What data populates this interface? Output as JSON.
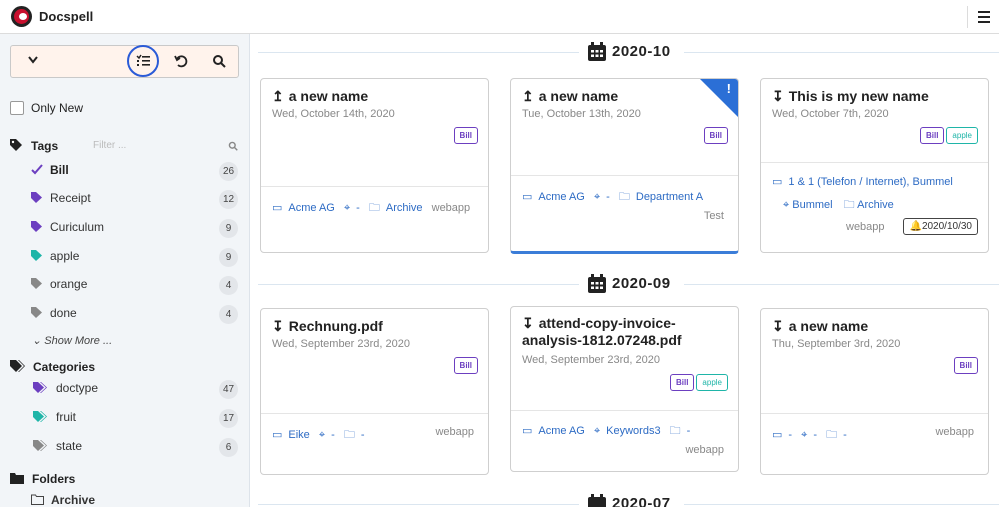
{
  "app": {
    "title": "Docspell"
  },
  "sidebar": {
    "only_new_label": "Only New",
    "tags_title": "Tags",
    "filter_placeholder": "Filter ...",
    "tags": [
      {
        "name": "Bill",
        "count": "26",
        "color": "#6c3fc0",
        "active": true
      },
      {
        "name": "Receipt",
        "count": "12",
        "color": "#6c3fc0"
      },
      {
        "name": "Curiculum",
        "count": "9",
        "color": "#6c3fc0"
      },
      {
        "name": "apple",
        "count": "9",
        "color": "#1fb5a8"
      },
      {
        "name": "orange",
        "count": "4",
        "color": "#888888"
      },
      {
        "name": "done",
        "count": "4",
        "color": "#888888"
      }
    ],
    "show_more": "Show More ...",
    "categories_title": "Categories",
    "categories": [
      {
        "name": "doctype",
        "count": "47",
        "color": "#6c3fc0"
      },
      {
        "name": "fruit",
        "count": "17",
        "color": "#1fb5a8"
      },
      {
        "name": "state",
        "count": "6",
        "color": "#888888"
      }
    ],
    "folders_title": "Folders",
    "folders": [
      {
        "name": "Archive"
      }
    ]
  },
  "groups": [
    {
      "month": "2020-10"
    },
    {
      "month": "2020-09"
    },
    {
      "month": "2020-07"
    }
  ],
  "cards": [
    {
      "title": "a new name",
      "direction": "↥",
      "date": "Wed, October 14th, 2020",
      "tags": [
        "Bill"
      ],
      "correspondent": "Acme AG",
      "concerning": "-",
      "folder": "Archive",
      "source": "webapp"
    },
    {
      "title": "a new name",
      "direction": "↥",
      "date": "Tue, October 13th, 2020",
      "tags": [
        "Bill"
      ],
      "correspondent": "Acme AG",
      "concerning": "-",
      "folder": "Department A",
      "source": "Test",
      "new_mark": "!"
    },
    {
      "title": "This is my new name",
      "direction": "↧",
      "date": "Wed, October 7th, 2020",
      "tags": [
        "Bill",
        "apple"
      ],
      "correspondent": "1 & 1 (Telefon / Internet), Bummel",
      "concerning": "Bummel",
      "folder": "Archive",
      "source": "webapp",
      "due": "2020/10/30"
    },
    {
      "title": "Rechnung.pdf",
      "direction": "↧",
      "date": "Wed, September 23rd, 2020",
      "tags": [
        "Bill"
      ],
      "correspondent": "Eike",
      "concerning": "-",
      "folder": "-",
      "source": "webapp"
    },
    {
      "title_line1": "attend-copy-invoice-",
      "title_line2": "analysis-1812.07248.pdf",
      "direction": "↧",
      "date": "Wed, September 23rd, 2020",
      "tags": [
        "Bill",
        "apple"
      ],
      "correspondent": "Acme AG",
      "concerning": "Keywords3",
      "folder": "-",
      "source": "webapp"
    },
    {
      "title": "a new name",
      "direction": "↧",
      "date": "Thu, September 3rd, 2020",
      "tags": [
        "Bill"
      ],
      "correspondent": "-",
      "concerning": "-",
      "folder": "-",
      "source": "webapp"
    }
  ]
}
